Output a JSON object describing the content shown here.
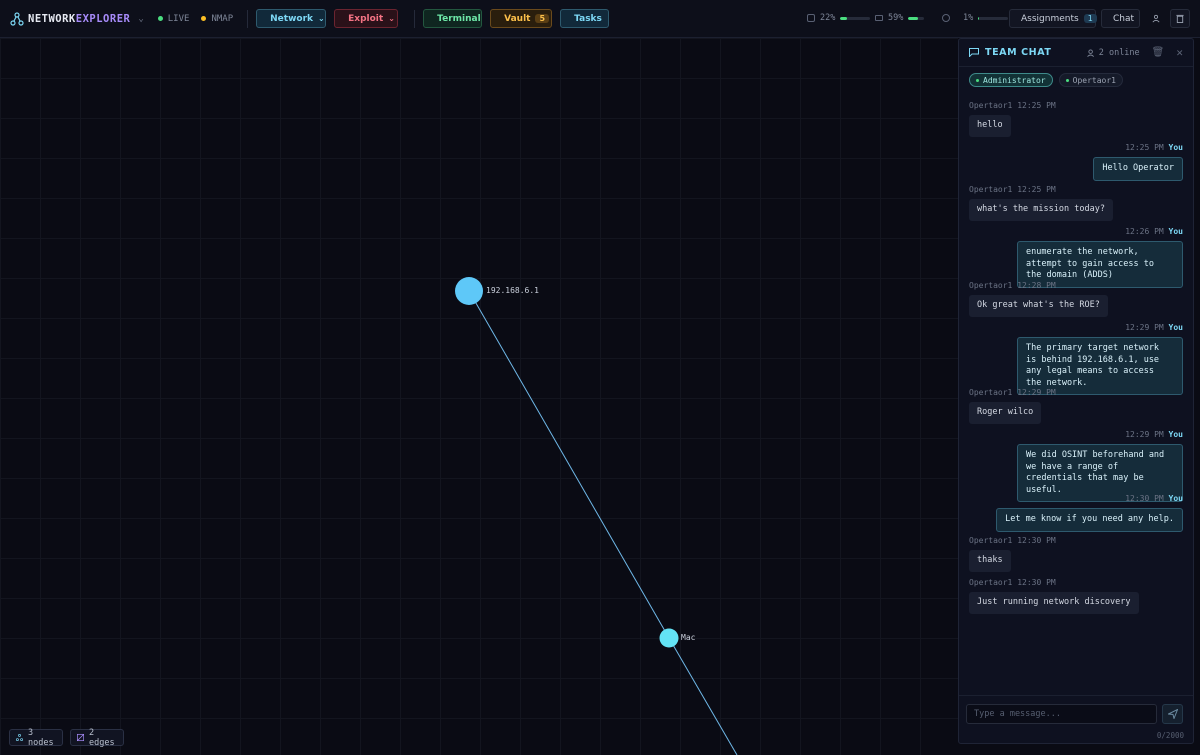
{
  "brand": {
    "part1": "NETWORK",
    "part2": "EXPLORER"
  },
  "status": [
    {
      "label": "LIVE",
      "color": "#4ade80"
    },
    {
      "label": "NMAP",
      "color": "#fbbf24"
    }
  ],
  "toolbar": {
    "network": "Network",
    "exploit": "Exploit",
    "terminal": "Terminal",
    "vault": "Vault",
    "vault_count": "5",
    "tasks": "Tasks"
  },
  "metrics": [
    {
      "value": "22%",
      "level": 0.22
    },
    {
      "value": "59%",
      "level": 0.59
    },
    {
      "value": "1%",
      "level": 0.01
    }
  ],
  "topright": {
    "assignments": "Assignments",
    "assignments_count": "1",
    "chat": "Chat"
  },
  "graph": {
    "nodes": [
      {
        "label": "192.168.6.1"
      },
      {
        "label": "Mac"
      }
    ],
    "stats": {
      "nodes": "3 nodes",
      "edges": "2 edges"
    }
  },
  "chat": {
    "title": "TEAM CHAT",
    "online": "2 online",
    "users": [
      "Administrator",
      "Opertaor1"
    ],
    "messages": [
      {
        "dir": "in",
        "author": "Opertaor1",
        "time": "12:25 PM",
        "text": "hello"
      },
      {
        "dir": "out",
        "author": "You",
        "time": "12:25 PM",
        "text": "Hello Operator"
      },
      {
        "dir": "in",
        "author": "Opertaor1",
        "time": "12:25 PM",
        "text": "what's the mission today?"
      },
      {
        "dir": "out",
        "author": "You",
        "time": "12:26 PM",
        "text": "enumerate the network, attempt to gain access to the domain (ADDS)"
      },
      {
        "dir": "in",
        "author": "Opertaor1",
        "time": "12:28 PM",
        "text": "Ok great what's the ROE?"
      },
      {
        "dir": "out",
        "author": "You",
        "time": "12:29 PM",
        "text": "The primary target network is behind 192.168.6.1, use any legal means to access the network."
      },
      {
        "dir": "in",
        "author": "Opertaor1",
        "time": "12:29 PM",
        "text": "Roger wilco"
      },
      {
        "dir": "out",
        "author": "You",
        "time": "12:29 PM",
        "text": "We did OSINT beforehand and we have a range of credentials that may be useful."
      },
      {
        "dir": "out",
        "author": "You",
        "time": "12:30 PM",
        "text": "Let me know if you need any help."
      },
      {
        "dir": "in",
        "author": "Opertaor1",
        "time": "12:30 PM",
        "text": "thaks"
      },
      {
        "dir": "in",
        "author": "Opertaor1",
        "time": "12:30 PM",
        "text": "Just running network discovery"
      }
    ],
    "input_placeholder": "Type a message...",
    "char_count": "0/2000"
  }
}
